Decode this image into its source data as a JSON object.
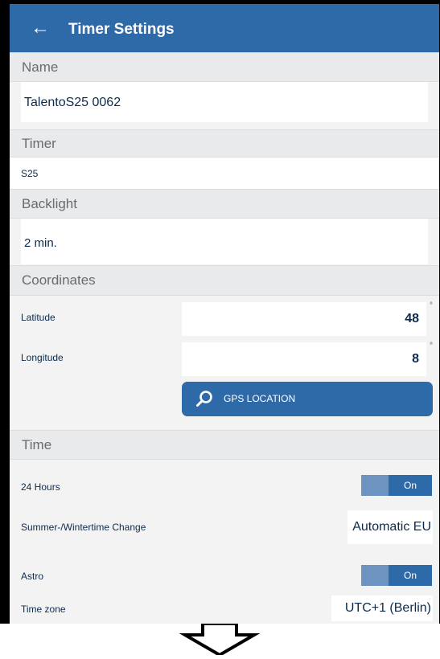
{
  "header": {
    "title": "Timer Settings"
  },
  "sections": {
    "name": {
      "title": "Name",
      "value": "TalentoS25 0062"
    },
    "timer": {
      "title": "Timer",
      "value": "S25"
    },
    "backlight": {
      "title": "Backlight",
      "value": "2 min."
    },
    "coordinates": {
      "title": "Coordinates",
      "latitude_label": "Latitude",
      "latitude_value": "48",
      "longitude_label": "Longitude",
      "longitude_value": "8",
      "degree_symbol": "°",
      "gps_button_label": "GPS LOCATION"
    },
    "time": {
      "title": "Time",
      "hours24_label": "24 Hours",
      "hours24_state": "On",
      "summer_label": "Summer-/Wintertime Change",
      "summer_value": "Automatic EU",
      "astro_label": "Astro",
      "astro_state": "On",
      "timezone_label": "Time zone",
      "timezone_value": "UTC+1 (Berlin)"
    }
  },
  "icons": {
    "back": "arrow-left-icon",
    "gps": "search-icon",
    "scroll_hint": "down-arrow-icon"
  },
  "colors": {
    "primary": "#2f6aa8",
    "toggle_knob": "#6d94c1",
    "section_bg": "#e9eaec",
    "text_dark": "#0d2a4d"
  }
}
